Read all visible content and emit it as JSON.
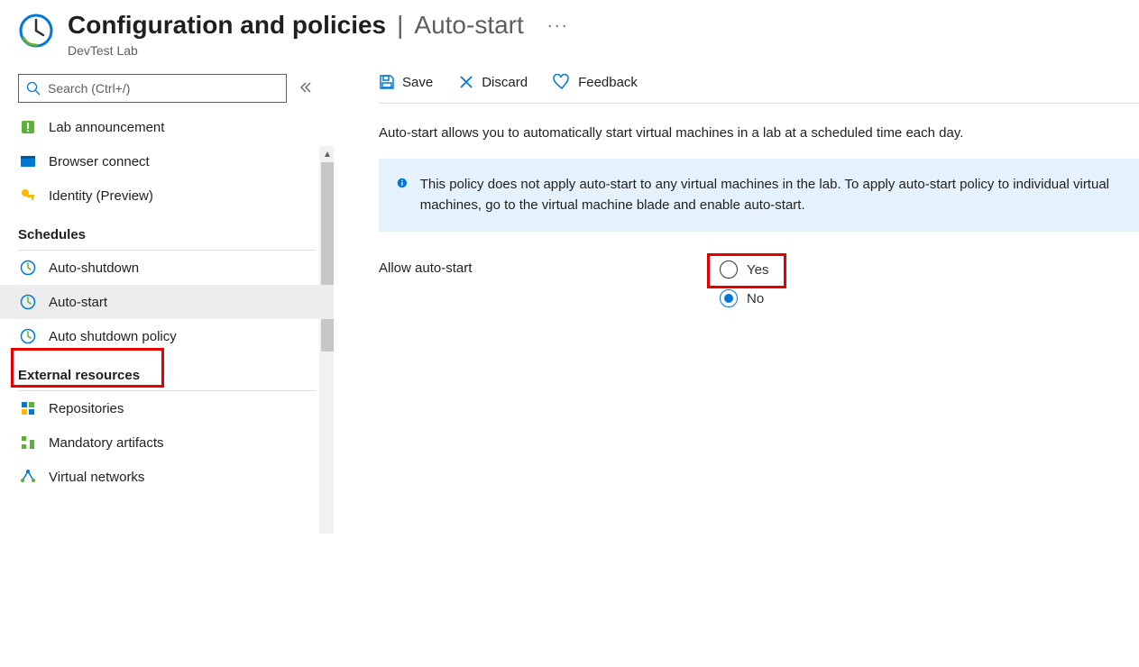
{
  "header": {
    "title_main": "Configuration and policies",
    "title_sub": "Auto-start",
    "subtitle": "DevTest Lab"
  },
  "search": {
    "placeholder": "Search (Ctrl+/)"
  },
  "sidebar": {
    "top_items": [
      {
        "label": "Lab announcement",
        "icon": "announce"
      },
      {
        "label": "Browser connect",
        "icon": "browser"
      },
      {
        "label": "Identity (Preview)",
        "icon": "key"
      }
    ],
    "sections": [
      {
        "title": "Schedules",
        "items": [
          {
            "label": "Auto-shutdown",
            "icon": "clock"
          },
          {
            "label": "Auto-start",
            "icon": "clock",
            "active": true
          },
          {
            "label": "Auto shutdown policy",
            "icon": "clock"
          }
        ]
      },
      {
        "title": "External resources",
        "items": [
          {
            "label": "Repositories",
            "icon": "repo"
          },
          {
            "label": "Mandatory artifacts",
            "icon": "artifact"
          },
          {
            "label": "Virtual networks",
            "icon": "network"
          }
        ]
      }
    ]
  },
  "toolbar": {
    "save": "Save",
    "discard": "Discard",
    "feedback": "Feedback"
  },
  "main": {
    "description": "Auto-start allows you to automatically start virtual machines in a lab at a scheduled time each day.",
    "info": "This policy does not apply auto-start to any virtual machines in the lab. To apply auto-start policy to individual virtual machines, go to the virtual machine blade and enable auto-start.",
    "form": {
      "allow_label": "Allow auto-start",
      "yes": "Yes",
      "no": "No",
      "selected": "no"
    }
  }
}
